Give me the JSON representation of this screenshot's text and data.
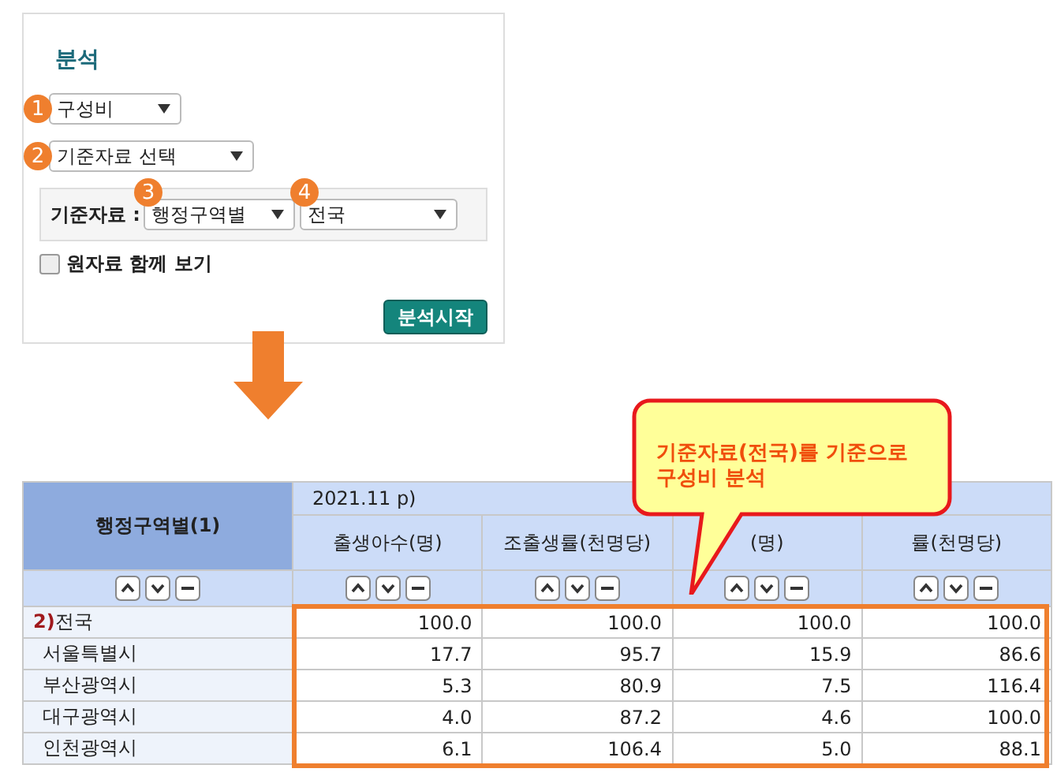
{
  "panel": {
    "title": "분석",
    "selects": [
      {
        "badge": "1",
        "value": "구성비"
      },
      {
        "badge": "2",
        "value": "기준자료 선택"
      }
    ],
    "base": {
      "label": "기준자료 :",
      "selects": [
        {
          "badge": "3",
          "value": "행정구역별"
        },
        {
          "badge": "4",
          "value": "전국"
        }
      ]
    },
    "raw_checkbox": {
      "label": "원자료 함께 보기",
      "checked": false
    },
    "start_button": "분석시작"
  },
  "callout": {
    "text": "기준자료(전국)를 기준으로\n구성비 분석"
  },
  "table": {
    "row_header": "행정구역별(1)",
    "period": "2021.11 p)",
    "columns": [
      "출생아수(명)",
      "조출생률(천명당)",
      "(명)",
      "률(천명당)"
    ],
    "rows": [
      {
        "mark": "2)",
        "name": "전국",
        "values": [
          "100.0",
          "100.0",
          "100.0",
          "100.0"
        ]
      },
      {
        "name": "서울특별시",
        "values": [
          "17.7",
          "95.7",
          "15.9",
          "86.6"
        ]
      },
      {
        "name": "부산광역시",
        "values": [
          "5.3",
          "80.9",
          "7.5",
          "116.4"
        ]
      },
      {
        "name": "대구광역시",
        "values": [
          "4.0",
          "87.2",
          "4.6",
          "100.0"
        ]
      },
      {
        "name": "인천광역시",
        "values": [
          "6.1",
          "106.4",
          "5.0",
          "88.1"
        ]
      }
    ]
  }
}
